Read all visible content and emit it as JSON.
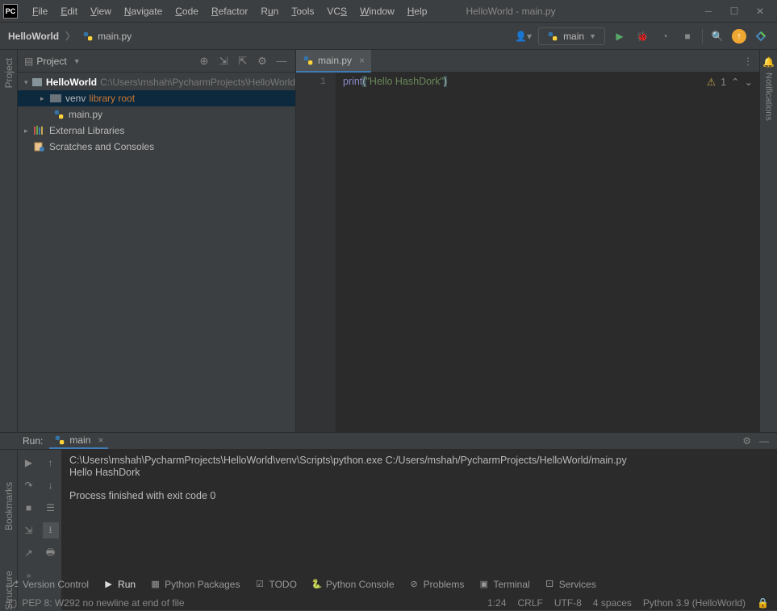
{
  "window": {
    "title": "HelloWorld - main.py",
    "app_icon": "PC"
  },
  "menu": [
    "File",
    "Edit",
    "View",
    "Navigate",
    "Code",
    "Refactor",
    "Run",
    "Tools",
    "VCS",
    "Window",
    "Help"
  ],
  "breadcrumb": {
    "project": "HelloWorld",
    "file": "main.py"
  },
  "run_config": {
    "label": "main"
  },
  "project_tool": {
    "title": "Project",
    "tree": {
      "root": {
        "name": "HelloWorld",
        "path": "C:\\Users\\mshah\\PycharmProjects\\HelloWorld"
      },
      "venv": {
        "name": "venv",
        "tag": "library root"
      },
      "file": "main.py",
      "ext_lib": "External Libraries",
      "scratches": "Scratches and Consoles"
    }
  },
  "editor": {
    "tab": "main.py",
    "line_no": "1",
    "code": {
      "fn": "print",
      "open": "(",
      "str": "\"Hello HashDork\"",
      "close": ")"
    },
    "warnings": "1"
  },
  "run_panel": {
    "label": "Run:",
    "tab": "main",
    "output_cmd": "C:\\Users\\mshah\\PycharmProjects\\HelloWorld\\venv\\Scripts\\python.exe C:/Users/mshah/PycharmProjects/HelloWorld/main.py",
    "output_print": "Hello HashDork",
    "output_exit": "Process finished with exit code 0"
  },
  "bottom_tabs": {
    "vcs": "Version Control",
    "run": "Run",
    "pkgs": "Python Packages",
    "todo": "TODO",
    "console": "Python Console",
    "problems": "Problems",
    "terminal": "Terminal",
    "services": "Services"
  },
  "status": {
    "message": "PEP 8: W292 no newline at end of file",
    "line_col": "1:24",
    "line_sep": "CRLF",
    "encoding": "UTF-8",
    "indent": "4 spaces",
    "interpreter": "Python 3.9 (HelloWorld)"
  },
  "side_labels": {
    "project": "Project",
    "bookmarks": "Bookmarks",
    "structure": "Structure",
    "notifications": "Notifications"
  }
}
